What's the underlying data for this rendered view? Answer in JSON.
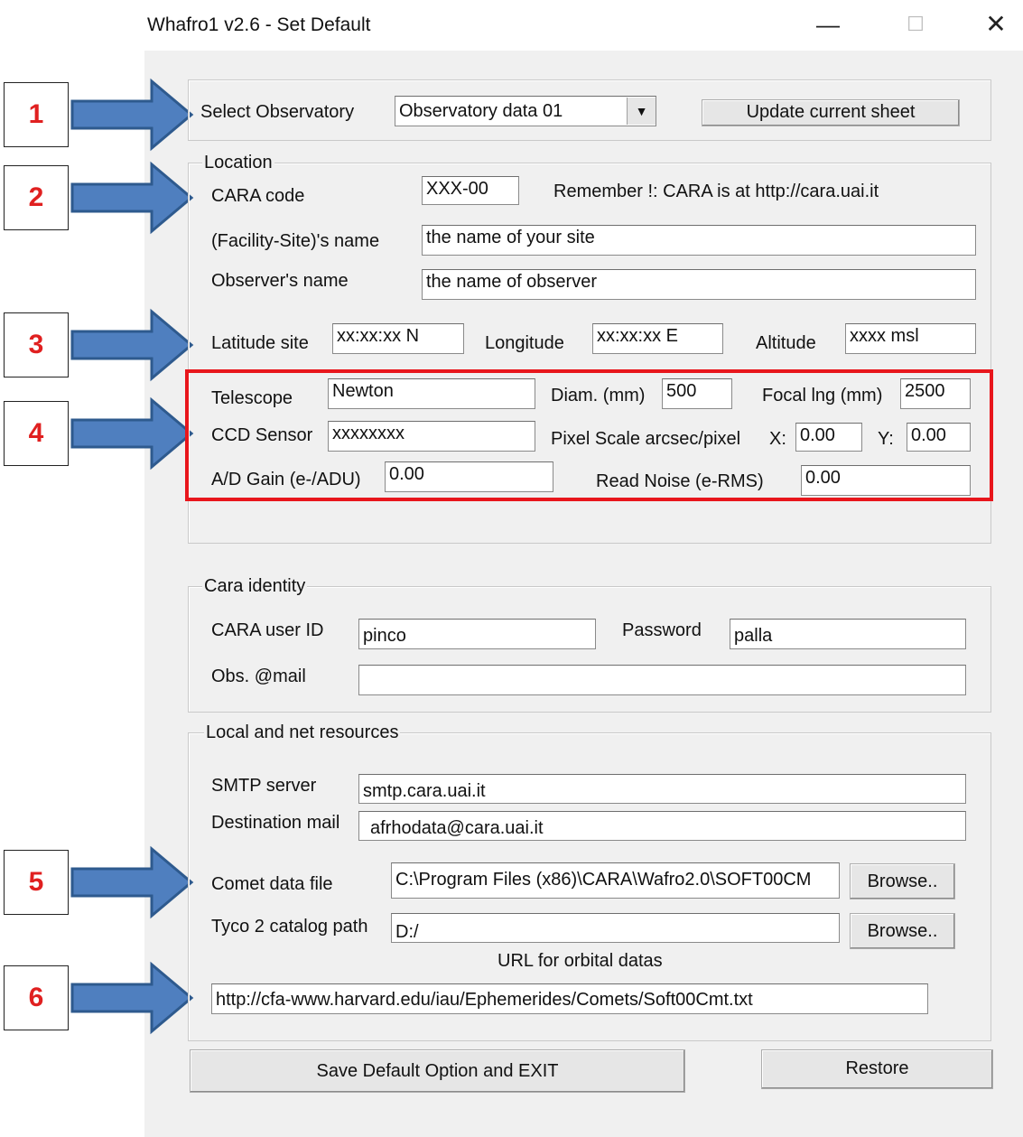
{
  "window": {
    "title": "Whafro1  v2.6 -  Set Default",
    "minimize_icon": "minimize-icon",
    "maximize_icon": "maximize-icon",
    "close_icon": "close-icon"
  },
  "callouts": [
    "1",
    "2",
    "3",
    "4",
    "5",
    "6"
  ],
  "observatory": {
    "label": "Select Observatory",
    "selected": "Observatory data 01",
    "update_button": "Update current sheet"
  },
  "location": {
    "legend": "Location",
    "cara_code_label": "CARA code",
    "cara_code_value": "XXX-00",
    "remember_text": "Remember !: CARA is at http://cara.uai.it",
    "site_name_label": "(Facility-Site)'s name",
    "site_name_value": "the name of your site",
    "observer_label": "Observer's name",
    "observer_value": "the name of observer",
    "latitude_label": "Latitude site",
    "latitude_value": "xx:xx:xx N",
    "longitude_label": "Longitude",
    "longitude_value": "xx:xx:xx E",
    "altitude_label": "Altitude",
    "altitude_value": "xxxx msl",
    "telescope_label": "Telescope",
    "telescope_value": "Newton",
    "diam_label": "Diam. (mm)",
    "diam_value": "500",
    "focal_label": "Focal lng (mm)",
    "focal_value": "2500",
    "ccd_label": "CCD Sensor",
    "ccd_value": "xxxxxxxx",
    "pixel_scale_label": "Pixel Scale arcsec/pixel",
    "x_label": "X:",
    "x_value": "0.00",
    "y_label": "Y:",
    "y_value": "0.00",
    "gain_label": "A/D Gain (e-/ADU)",
    "gain_value": "0.00",
    "read_noise_label": "Read Noise (e-RMS)",
    "read_noise_value": "0.00"
  },
  "identity": {
    "legend": "Cara identity",
    "user_label": "CARA user ID",
    "user_value": "pinco",
    "password_label": "Password",
    "password_value": "palla",
    "mail_label": "Obs. @mail",
    "mail_value": ""
  },
  "resources": {
    "legend": "Local and net resources",
    "smtp_label": "SMTP server",
    "smtp_value": "smtp.cara.uai.it",
    "dest_label": "Destination mail",
    "dest_value": "afrhodata@cara.uai.it",
    "comet_label": "Comet data file",
    "comet_value": "C:\\Program Files (x86)\\CARA\\Wafro2.0\\SOFT00CM",
    "browse1": "Browse..",
    "tyco_label": "Tyco 2  catalog path",
    "tyco_value": "D:/",
    "browse2": "Browse..",
    "url_label": "URL for orbital datas",
    "url_value": "http://cfa-www.harvard.edu/iau/Ephemerides/Comets/Soft00Cmt.txt"
  },
  "footer": {
    "save_button": "Save Default Option and EXIT",
    "restore_button": "Restore"
  },
  "colors": {
    "callout_text": "#e02020",
    "highlight_box": "#e8161c",
    "arrow_fill": "#4f7fbf",
    "arrow_stroke": "#2e5a8e",
    "dialog_bg": "#f0f0f0"
  }
}
